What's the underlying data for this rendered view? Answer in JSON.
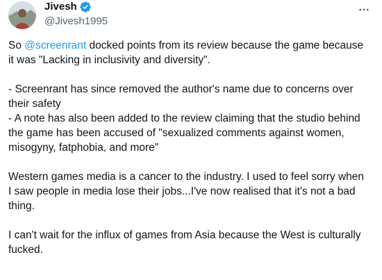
{
  "author": {
    "display_name": "Jivesh",
    "handle": "@Jivesh1995",
    "avatar_icon": "avatar-photo",
    "verified_icon": "verified-badge-icon",
    "verified_color": "#1d9bf0"
  },
  "menu": {
    "more_icon": "more-horizontal-icon"
  },
  "tweet": {
    "p1_prefix": "So ",
    "p1_mention": "@screenrant",
    "p1_rest": " docked points from its review because the game because it was \"Lacking in inclusivity and diversity\".",
    "p2_line1": "- Screenrant has since removed the author's name due to concerns over their safety",
    "p2_line2": "- A note has also been added to the review claiming that the studio behind the game has been accused of \"sexualized comments against women, misogyny, fatphobia, and more\"",
    "p3": "Western games media is a cancer to the industry. I used to feel sorry when I saw people in media lose their jobs...I've now realised that it's not a bad thing.",
    "p4": "I can't wait for the influx of games from Asia because the West is culturally fucked."
  },
  "colors": {
    "text": "#0f1419",
    "secondary": "#536471",
    "link": "#1d9bf0"
  }
}
